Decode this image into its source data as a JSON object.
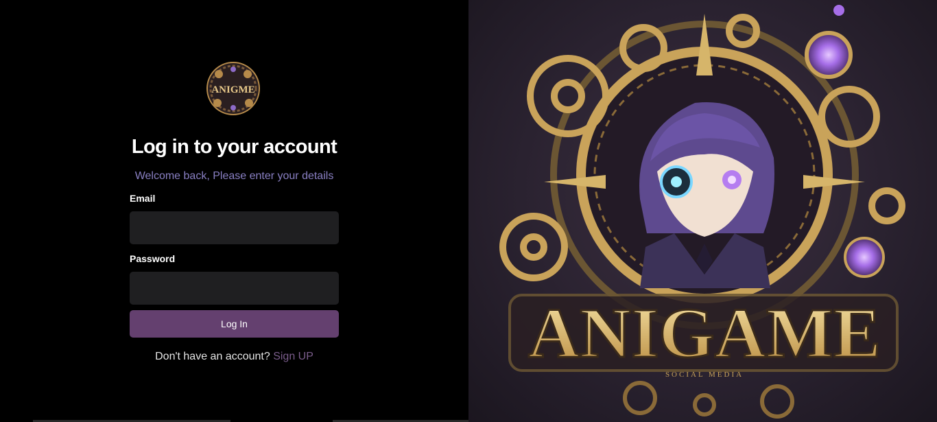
{
  "logo": {
    "text": "ANIGME"
  },
  "login": {
    "title": "Log in to your account",
    "subtitle": "Welcome back, Please enter your details",
    "email_label": "Email",
    "email_value": "",
    "password_label": "Password",
    "password_value": "",
    "button_label": "Log In",
    "no_account_text": "Don't have an account?",
    "signup_link": "Sign UP"
  },
  "hero": {
    "title": "ANIGAME",
    "tagline": "SOCIAL MEDIA"
  },
  "colors": {
    "background": "#000000",
    "input_bg": "#1f1f21",
    "button": "#64406f",
    "subtitle": "#8a80c4",
    "link": "#7b5d8c",
    "gold": "#d6b56a",
    "purple": "#8d6bc8"
  }
}
